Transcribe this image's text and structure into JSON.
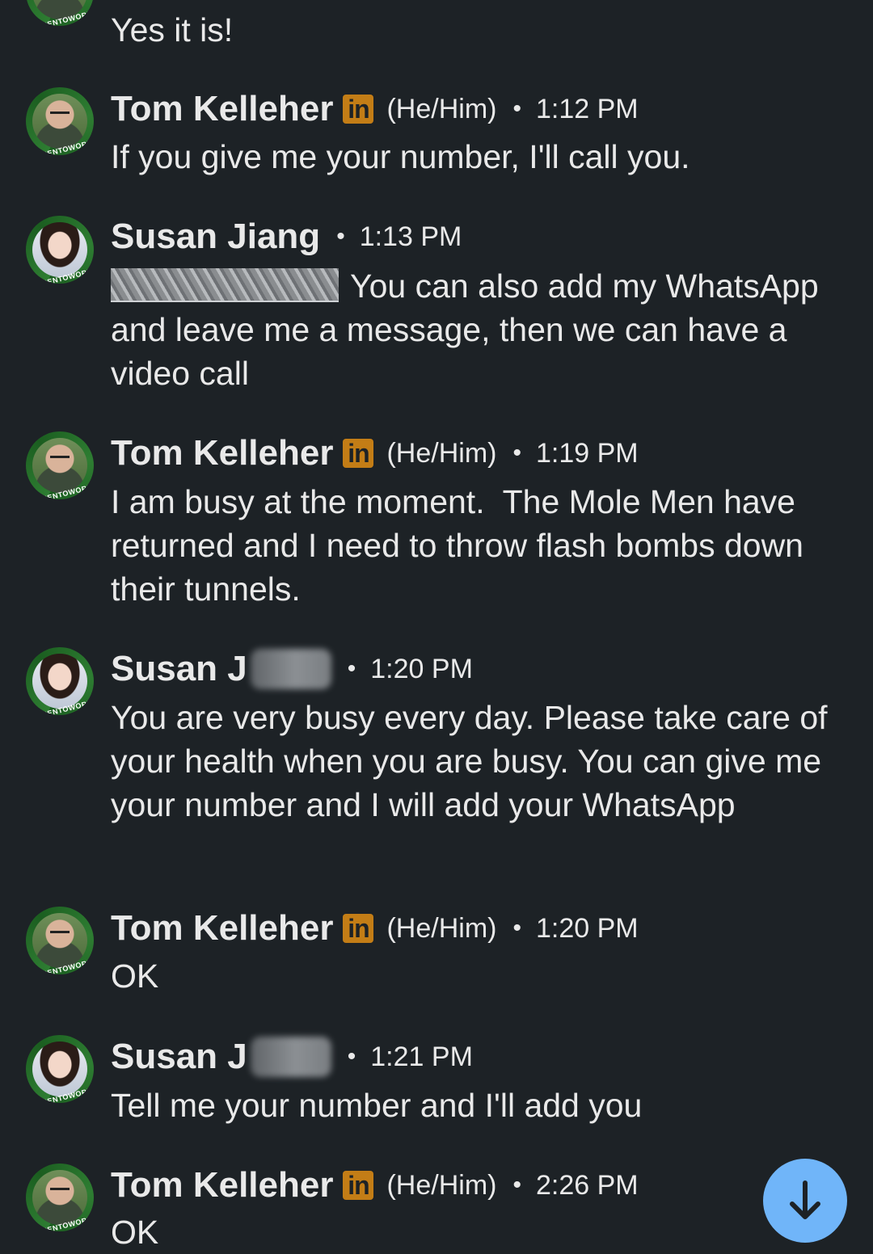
{
  "messages": [
    {
      "text": "Yes it is!"
    },
    {
      "sender": "Tom Kelleher",
      "linkedin_badge": "in",
      "pronoun": "(He/Him)",
      "separator": "•",
      "time": "1:12 PM",
      "text": "If you give me your number, I'll call you."
    },
    {
      "sender": "Susan Jiang",
      "separator": "•",
      "time": "1:13 PM",
      "text": "You can also add my WhatsApp and leave me a message, then we can have a video call"
    },
    {
      "sender": "Tom Kelleher",
      "linkedin_badge": "in",
      "pronoun": "(He/Him)",
      "separator": "•",
      "time": "1:19 PM",
      "text": "I am busy at the moment.  The Mole Men have returned and I need to throw flash bombs down their tunnels."
    },
    {
      "sender": "Susan J",
      "separator": "•",
      "time": "1:20 PM",
      "text": "You are very busy every day. Please take care of your health when you are busy. You can give me your number and I will add your WhatsApp"
    },
    {
      "sender": "Tom Kelleher",
      "linkedin_badge": "in",
      "pronoun": "(He/Him)",
      "separator": "•",
      "time": "1:20 PM",
      "text": "OK"
    },
    {
      "sender": "Susan J",
      "separator": "•",
      "time": "1:21 PM",
      "text": "Tell me your number and I'll add you"
    },
    {
      "sender": "Tom Kelleher",
      "linkedin_badge": "in",
      "pronoun": "(He/Him)",
      "separator": "•",
      "time": "2:26 PM",
      "text": "OK"
    }
  ],
  "avatar_badge": "#OPENTOWORK",
  "scroll_button": {
    "icon": "arrow-down-icon"
  },
  "colors": {
    "background": "#1d2226",
    "text": "#e9e9e9",
    "linkedin_badge": "#c37d16",
    "opentowork_ring": "#2e7d32",
    "scroll_button": "#70b5f9"
  }
}
